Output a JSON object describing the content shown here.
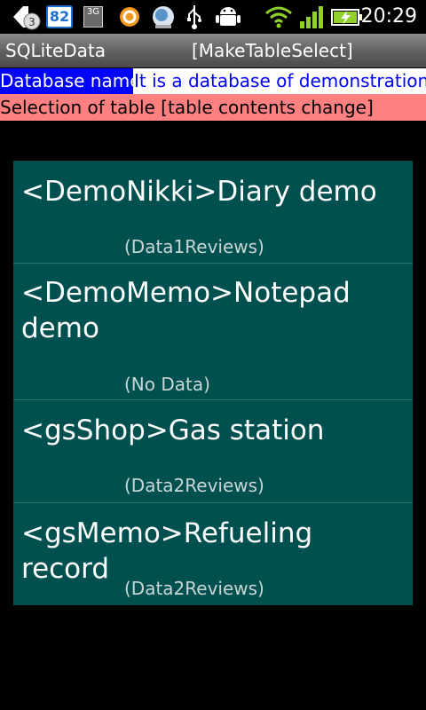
{
  "status_bar": {
    "time": "20:29",
    "badge_number": "82",
    "notification_count": "3",
    "network_type": "3G"
  },
  "title_bar": {
    "app_name": "SQLiteData",
    "screen_name": "[MakeTableSelect]"
  },
  "database": {
    "label": "Database name",
    "value": "It is a database of demonstration"
  },
  "selection_label": "Selection of table [table contents change]",
  "tables": [
    {
      "title": "<DemoNikki>Diary demo",
      "count": "(Data1Reviews)"
    },
    {
      "title": "<DemoMemo>Notepad demo",
      "count": "(No Data)"
    },
    {
      "title": "<gsShop>Gas station",
      "count": "(Data2Reviews)"
    },
    {
      "title": "<gsMemo>Refueling record",
      "count": "(Data2Reviews)"
    }
  ],
  "colors": {
    "db_label_bg": "#0000ff",
    "db_value_text": "#0000ff",
    "selection_bg": "#ff8080",
    "list_bg": "#005050"
  }
}
